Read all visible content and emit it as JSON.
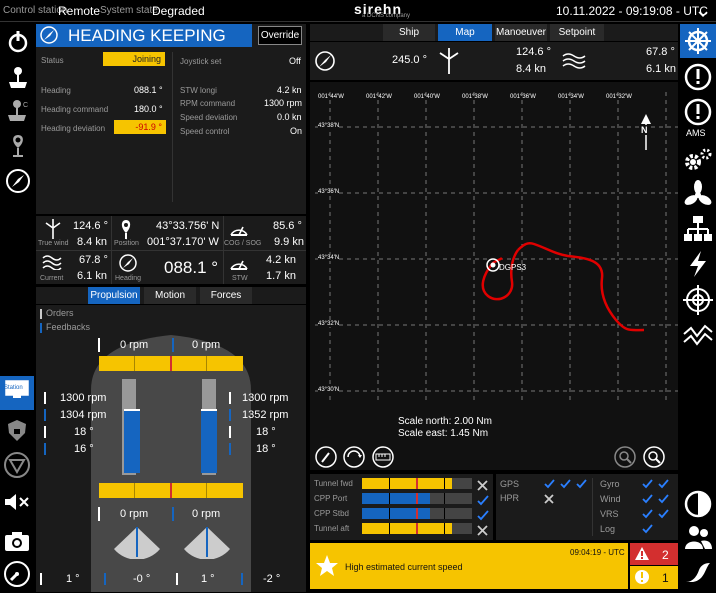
{
  "topbar": {
    "control_label": "Control station",
    "control_value": "Remote",
    "system_label": "System state",
    "system_value": "Degraded",
    "brand": "sirehn",
    "brand_sub": "a DCNS company",
    "datetime": "10.11.2022 - 09:19:08 - UTC"
  },
  "heading": {
    "title": "HEADING KEEPING",
    "override": "Override",
    "status_label": "Status",
    "status_value": "Joining",
    "heading_label": "Heading",
    "heading_value": "088.1 °",
    "cmd_label": "Heading command",
    "cmd_value": "180.0 °",
    "dev_label": "Heading deviation",
    "dev_value": "-91.9 °",
    "joy_label": "Joystick set",
    "joy_value": "Off",
    "stw_label": "STW longi",
    "stw_value": "4.2 kn",
    "rpm_label": "RPM command",
    "rpm_value": "1300 rpm",
    "speeddev_label": "Speed deviation",
    "speeddev_value": "0.0 kn",
    "speedctl_label": "Speed control",
    "speedctl_value": "On"
  },
  "nav": {
    "truewind_dir": "124.6 °",
    "truewind_speed": "8.4 kn",
    "truewind_label": "True wind",
    "lat": "43°33.756' N",
    "lon": "001°37.170' W",
    "pos_label": "Position",
    "cog": "85.6 °",
    "sog": "9.9 kn",
    "cogsog_label": "COG / SOG",
    "current_dir": "67.8 °",
    "current_speed": "6.1 kn",
    "current_label": "Current",
    "heading_big": "088.1 °",
    "heading_label": "Heading",
    "stw1": "4.2 kn",
    "stw2": "1.7 kn",
    "stw_label": "STW"
  },
  "ptabs": {
    "propulsion": "Propulsion",
    "motion": "Motion",
    "forces": "Forces"
  },
  "legend": {
    "orders": "Orders",
    "feedbacks": "Feedbacks"
  },
  "prop": {
    "fwd_left_rpm": "0 rpm",
    "fwd_right_rpm": "0 rpm",
    "left_cmd_rpm": "1300 rpm",
    "left_fb_rpm": "1304 rpm",
    "left_cmd_angle": "18 °",
    "left_fb_angle": "16 °",
    "right_cmd_rpm": "1300 rpm",
    "right_fb_rpm": "1352 rpm",
    "right_cmd_angle": "18 °",
    "right_fb_angle": "18 °",
    "aft_left_rpm": "0 rpm",
    "aft_right_rpm": "0 rpm",
    "rud1": "1 °",
    "rud2": "-0 °",
    "rud3": "1 °",
    "rud4": "-2 °"
  },
  "maptabs": {
    "ship": "Ship",
    "map": "Map",
    "manoeuver": "Manoeuver",
    "setpoint": "Setpoint"
  },
  "mapinfo": {
    "heading": "245.0 °",
    "wind_dir": "124.6 °",
    "wind_speed": "8.4 kn",
    "cur_dir": "67.8 °",
    "cur_speed": "6.1 kn",
    "north": "N"
  },
  "map": {
    "lon_ticks": [
      "001°44'W",
      "001°42'W",
      "001°40'W",
      "001°38'W",
      "001°36'W",
      "001°34'W",
      "001°32'W"
    ],
    "lat_ticks": [
      "43°38'N",
      "43°36'N",
      "43°34'N",
      "43°32'N",
      "43°30'N"
    ],
    "gps_label": "DGPS3",
    "scale_north": "Scale north: 2.00 Nm",
    "scale_east": "Scale east: 1.45 Nm"
  },
  "thrusters": [
    {
      "label": "Tunnel fwd",
      "fill": 0.82,
      "ok": false
    },
    {
      "label": "CPP Port",
      "fill": 0.62,
      "ok": true
    },
    {
      "label": "CPP Stbd",
      "fill": 0.62,
      "ok": true
    },
    {
      "label": "Tunnel aft",
      "fill": 0.82,
      "ok": false
    }
  ],
  "sensors_left": {
    "gps": "GPS",
    "hpr": "HPR"
  },
  "sensors_right": {
    "gyro": "Gyro",
    "wind": "Wind",
    "vrs": "VRS",
    "log": "Log"
  },
  "alarm": {
    "time": "09:04:19 - UTC",
    "text": "High estimated current speed",
    "count_red": "2",
    "count_yellow": "1"
  },
  "rightbar": {
    "ams": "AMS"
  },
  "leftbar": {
    "station": "Station"
  },
  "colors": {
    "accent": "#1565c0",
    "warn": "#f6c400",
    "alarm": "#d32f2f",
    "track": "#e00000"
  }
}
